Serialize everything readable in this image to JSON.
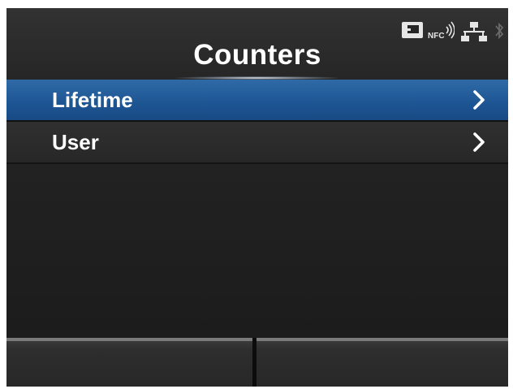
{
  "header": {
    "title": "Counters",
    "status_icons": [
      {
        "name": "card-slot-icon"
      },
      {
        "name": "nfc-icon",
        "text": "NFC"
      },
      {
        "name": "network-icon"
      },
      {
        "name": "bluetooth-icon"
      }
    ]
  },
  "menu": {
    "items": [
      {
        "label": "Lifetime",
        "selected": true
      },
      {
        "label": "User",
        "selected": false
      }
    ]
  },
  "softkeys": {
    "left_label": "",
    "right_label": ""
  },
  "colors": {
    "selected_row": "#1d5593",
    "background": "#232323",
    "text": "#ffffff"
  }
}
